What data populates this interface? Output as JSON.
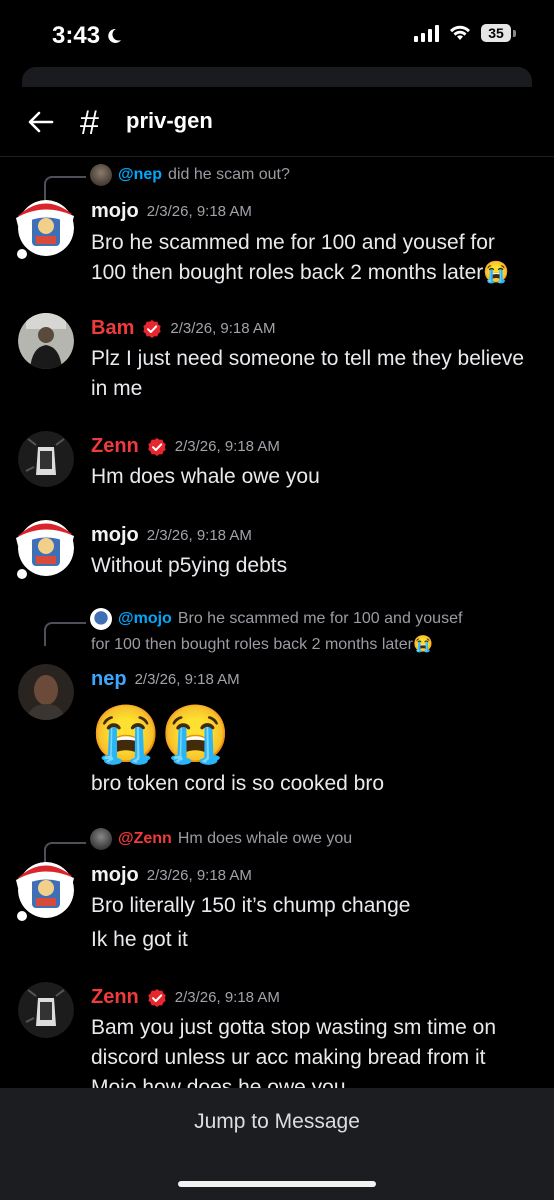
{
  "status": {
    "time": "3:43",
    "battery": "35"
  },
  "header": {
    "hash": "#",
    "channel": "priv-gen"
  },
  "messages": [
    {
      "reply_to": "@nep",
      "reply_text": "did he scam out?",
      "author": "mojo",
      "time": "2/3/26, 9:18 AM",
      "lines": [
        "Bro he scammed me for 100 and yousef for",
        "100 then bought roles back 2 months later😭"
      ]
    },
    {
      "author": "Bam",
      "time": "2/3/26, 9:18 AM",
      "lines": [
        "Plz I just need someone to tell me they believe",
        "in me"
      ]
    },
    {
      "author": "Zenn",
      "time": "2/3/26, 9:18 AM",
      "lines": [
        "Hm does whale owe you"
      ]
    },
    {
      "author": "mojo",
      "time": "2/3/26, 9:18 AM",
      "lines": [
        "Without p5ying debts"
      ]
    },
    {
      "reply_to": "@mojo",
      "reply_text": "Bro he scammed me for 100 and yousef",
      "reply_text2": "for 100 then bought roles back 2 months later😭",
      "author": "nep",
      "time": "2/3/26, 9:18 AM",
      "emoji": "😭😭",
      "lines": [
        "bro token cord is so cooked bro"
      ]
    },
    {
      "reply_to": "@Zenn",
      "reply_text": "Hm does whale owe you",
      "author": "mojo",
      "time": "2/3/26, 9:18 AM",
      "lines": [
        "Bro literally 150 it’s chump change",
        "Ik he got it"
      ]
    },
    {
      "author": "Zenn",
      "time": "2/3/26, 9:18 AM",
      "lines": [
        "Bam you just gotta stop wasting sm time on",
        "discord unless ur acc making bread from it",
        "Mojo how does he owe you"
      ]
    }
  ],
  "bottom": {
    "jump_label": "Jump to Message"
  },
  "colors": {
    "mojo": "#f2f3f5",
    "bam": "#ef3b3b",
    "zenn": "#ef3b3b",
    "nep": "#3ba7ff",
    "verified": "#e8262e"
  }
}
